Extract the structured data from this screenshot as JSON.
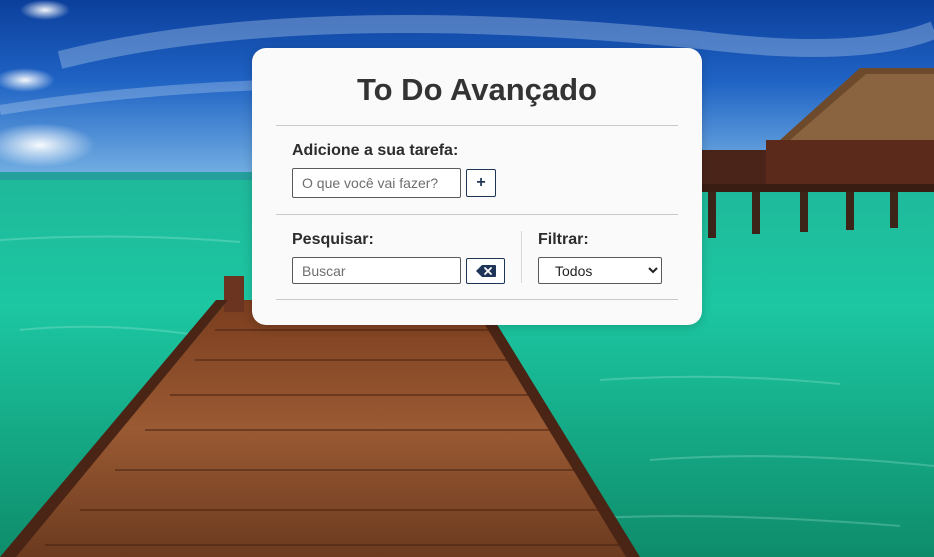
{
  "app": {
    "title": "To Do Avançado"
  },
  "add_section": {
    "label": "Adicione a sua tarefa:",
    "input_placeholder": "O que você vai fazer?",
    "input_value": "",
    "add_button_label": "+"
  },
  "search_section": {
    "label": "Pesquisar:",
    "input_placeholder": "Buscar",
    "input_value": "",
    "clear_button_icon": "backspace-icon"
  },
  "filter_section": {
    "label": "Filtrar:",
    "selected": "Todos",
    "options": [
      "Todos"
    ]
  },
  "background": {
    "icon": "tropical-beach-photo"
  },
  "colors": {
    "card_bg": "#fafafa",
    "accent": "#1f3558",
    "title_text": "#333333",
    "divider": "#c9c9c9"
  }
}
